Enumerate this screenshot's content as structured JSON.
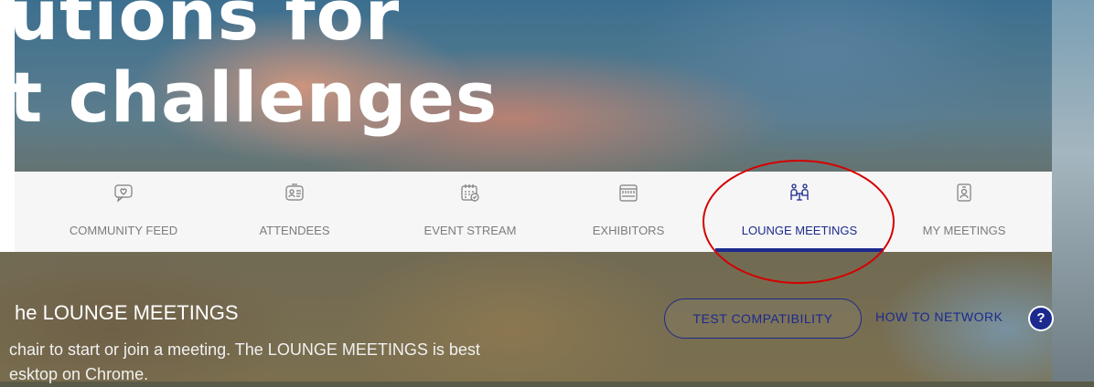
{
  "hero": {
    "line1": "utions for",
    "line2": "t challenges"
  },
  "nav": {
    "items": [
      {
        "label": "COMMUNITY FEED",
        "icon": "chat-heart-icon"
      },
      {
        "label": "ATTENDEES",
        "icon": "id-card-icon"
      },
      {
        "label": "EVENT STREAM",
        "icon": "calendar-check-icon"
      },
      {
        "label": "EXHIBITORS",
        "icon": "booth-icon"
      },
      {
        "label": "LOUNGE MEETINGS",
        "icon": "meeting-table-icon",
        "active": true
      },
      {
        "label": "MY MEETINGS",
        "icon": "badge-person-icon"
      }
    ],
    "active_color": "#1c2a8d",
    "inactive_color": "#7c7c7c"
  },
  "annotation": {
    "color": "#d50000",
    "target": "LOUNGE MEETINGS"
  },
  "content": {
    "title": "he LOUNGE MEETINGS",
    "desc_line1": "chair to start or join a meeting. The LOUNGE MEETINGS is best",
    "desc_line2": "esktop on Chrome.",
    "test_button": "TEST COMPATIBILITY",
    "network_link": "HOW TO NETWORK",
    "help_icon": "?"
  }
}
